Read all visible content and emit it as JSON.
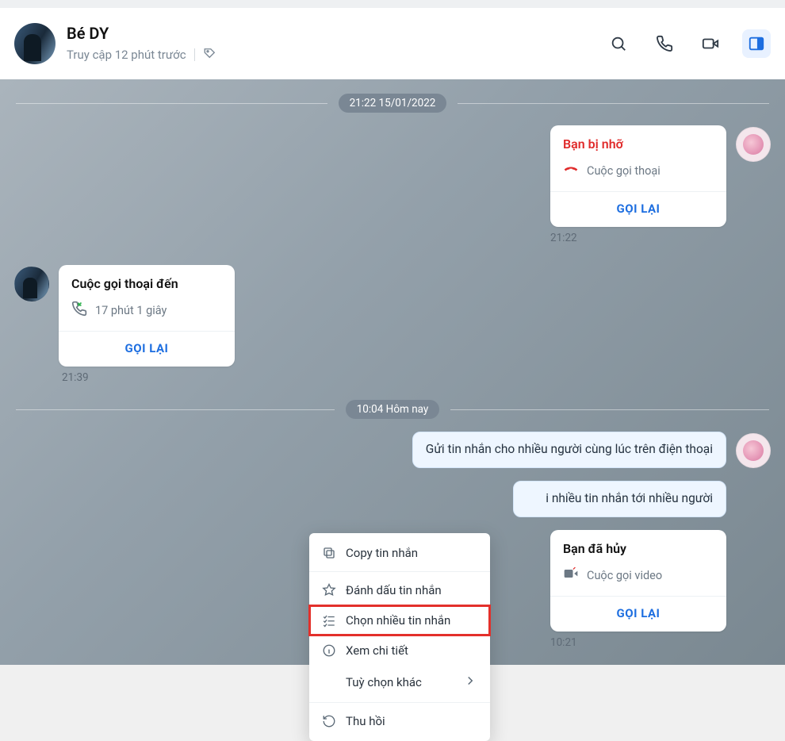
{
  "header": {
    "contact_name": "Bé DY",
    "last_seen": "Truy cập 12 phút trước"
  },
  "dividers": {
    "d1": "21:22 15/01/2022",
    "d2": "10:04 Hôm nay"
  },
  "calls": {
    "missed": {
      "title": "Bạn bị nhỡ",
      "subtitle": "Cuộc gọi thoại",
      "action": "GỌI LẠI",
      "time": "21:22"
    },
    "incoming": {
      "title": "Cuộc gọi thoại đến",
      "subtitle": "17 phút 1 giây",
      "action": "GỌI LẠI",
      "time": "21:39"
    },
    "cancelled": {
      "title": "Bạn đã hủy",
      "subtitle": "Cuộc gọi video",
      "action": "GỌI LẠI",
      "time": "10:21"
    }
  },
  "messages": {
    "m1": "Gửi tin nhắn cho nhiều người cùng lúc trên điện thoại",
    "m2": "i nhiều tin nhắn tới nhiều người"
  },
  "context_menu": {
    "copy": "Copy tin nhắn",
    "star": "Đánh dấu tin nhắn",
    "multi": "Chọn nhiều tin nhắn",
    "detail": "Xem chi tiết",
    "more": "Tuỳ chọn khác",
    "recall": "Thu hồi"
  }
}
